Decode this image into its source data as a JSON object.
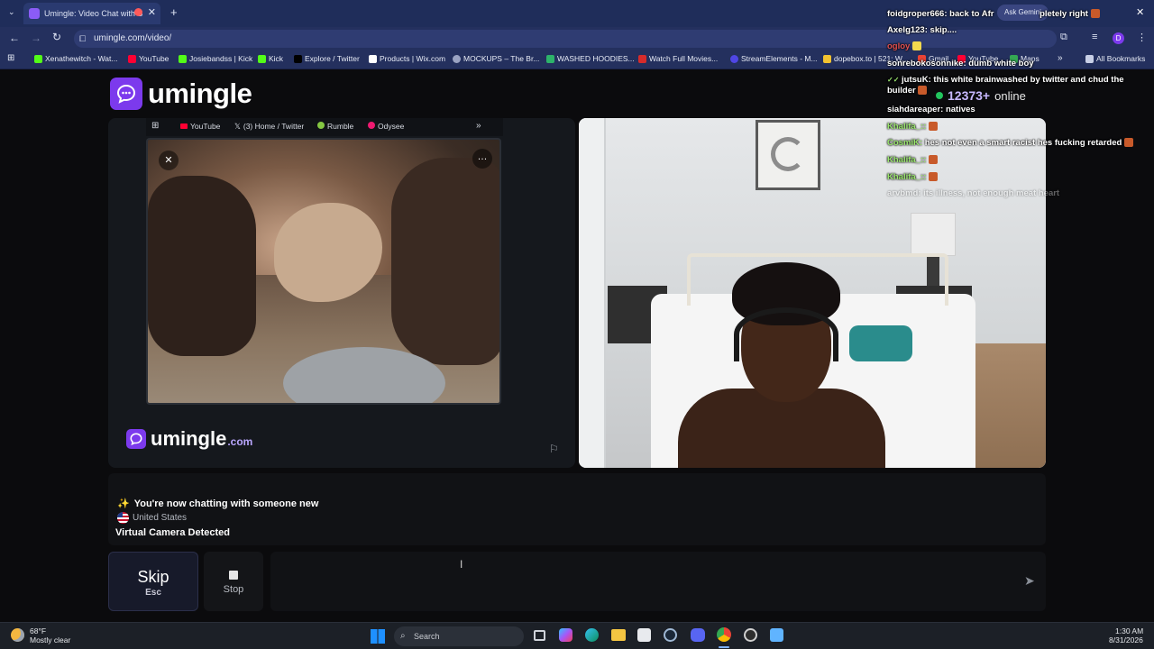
{
  "browser": {
    "tab_title": "Umingle: Video Chat with S",
    "url": "umingle.com/video/",
    "bookmarks": [
      "Xenathewitch - Wat...",
      "YouTube",
      "Josiebandss | Kick",
      "Kick",
      "Explore / Twitter",
      "Products | Wix.com",
      "MOCKUPS – The Br...",
      "WASHED HOODIES...",
      "Watch Full Movies...",
      "StreamElements - M...",
      "dopebox.to | 521: W...",
      "YouTube",
      "Gmail",
      "Maps"
    ],
    "all_bookmarks": "All Bookmarks",
    "ask_gemini": "Ask Gemini"
  },
  "site": {
    "logo": "umingle",
    "watermark": "umingle",
    "watermark_suffix": ".com",
    "online_count": "12373+",
    "online_label": "online"
  },
  "left_video": {
    "mini_tabs": [
      "YouTube",
      "(3) Home / Twitter",
      "Rumble",
      "Odysee"
    ]
  },
  "chat": {
    "line1": "You're now chatting with someone new",
    "country": "United States",
    "line3": "Virtual Camera Detected"
  },
  "controls": {
    "skip_label": "Skip",
    "skip_hint": "Esc",
    "stop_label": "Stop"
  },
  "taskbar": {
    "weather_temp": "68°F",
    "weather_desc": "Mostly clear",
    "search_placeholder": "Search",
    "time": "1:30 AM",
    "date": "8/31/2026"
  },
  "stream_chat": [
    {
      "user": "foidgroper666:",
      "text": "back to Afr",
      "color": "white",
      "tail": "pletely right"
    },
    {
      "user": "Axelg123:",
      "text": "skip....",
      "color": "white"
    },
    {
      "user": "ogloy",
      "text": "",
      "color": "red"
    },
    {
      "user": "sonrebokosonnike:",
      "text": "dumb white boy",
      "color": "white"
    },
    {
      "user": "jutsuK:",
      "text": "this white brainwashed by twitter and chud the builder",
      "color": "white"
    },
    {
      "user": "siahdareaper:",
      "text": "natives",
      "color": "white"
    },
    {
      "user": "Khalifa_::",
      "text": "",
      "color": "green"
    },
    {
      "user": "CosmiK:",
      "text": "hes not even a smart racist hes fucking retarded",
      "color": "green"
    },
    {
      "user": "Khalifa_::",
      "text": "",
      "color": "green"
    },
    {
      "user": "Khalifa_::",
      "text": "",
      "color": "green"
    },
    {
      "user": "arvbmd:",
      "text": "its illness, not enough meat heart",
      "color": "white"
    }
  ]
}
